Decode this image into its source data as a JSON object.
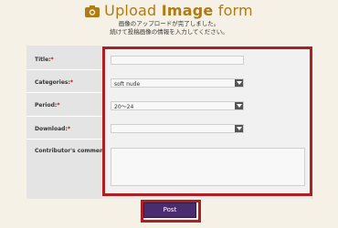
{
  "header": {
    "title_light": "Upload ",
    "title_bold": "Image",
    "title_rest": " form",
    "subtitle_line1": "画像のアップロードが完了しました。",
    "subtitle_line2": "続けて投稿画像の情報を入力してください。"
  },
  "form": {
    "title_label": "Title:",
    "categories_label": "Categories:",
    "period_label": "Period:",
    "download_label": "Download:",
    "comment_label": "Contributor's comment:",
    "required_mark": "*",
    "title_value": "",
    "categories_value": "soft nude",
    "period_value": "20〜24",
    "download_value": "",
    "comment_value": ""
  },
  "actions": {
    "post_label": "Post"
  },
  "colors": {
    "accent": "#b01e23",
    "title": "#b07a14",
    "button": "#4b2d6f"
  }
}
